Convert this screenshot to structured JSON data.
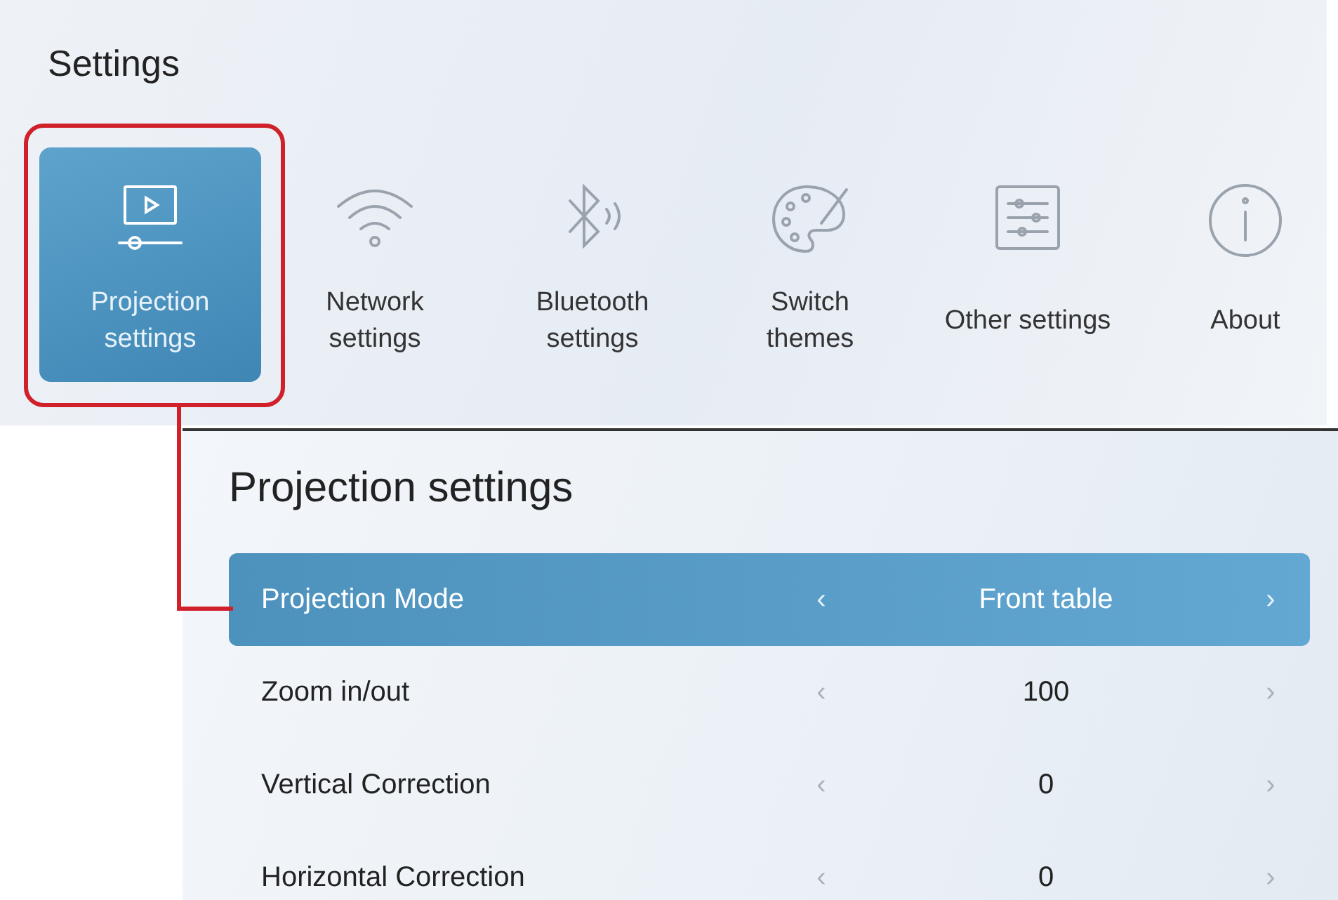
{
  "settings_screen": {
    "title": "Settings",
    "tiles": [
      {
        "kind": "projection",
        "label": "Projection\nsettings",
        "selected": true
      },
      {
        "kind": "network",
        "label": "Network\nsettings",
        "selected": false
      },
      {
        "kind": "bluetooth",
        "label": "Bluetooth\nsettings",
        "selected": false
      },
      {
        "kind": "themes",
        "label": "Switch\nthemes",
        "selected": false
      },
      {
        "kind": "other",
        "label": "Other settings",
        "selected": false
      },
      {
        "kind": "about",
        "label": "About",
        "selected": false
      }
    ]
  },
  "projection_panel": {
    "title": "Projection settings",
    "rows": [
      {
        "label": "Projection Mode",
        "prev": "‹",
        "value": "Front table",
        "next": "›",
        "selected": true
      },
      {
        "label": "Zoom in/out",
        "prev": "‹",
        "value": "100",
        "next": "›",
        "selected": false
      },
      {
        "label": "Vertical Correction",
        "prev": "‹",
        "value": "0",
        "next": "›",
        "selected": false
      },
      {
        "label": "Horizontal Correction",
        "prev": "‹",
        "value": "0",
        "next": "›",
        "selected": false
      }
    ]
  }
}
